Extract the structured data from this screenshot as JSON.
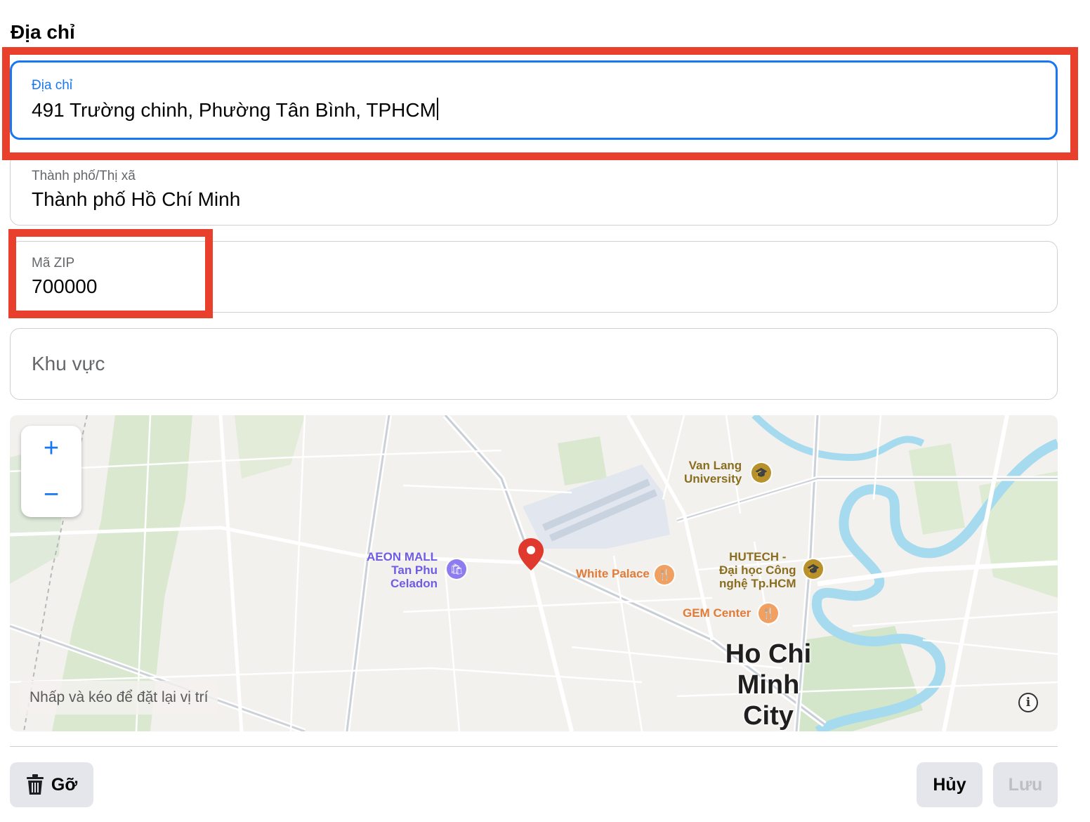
{
  "section_title": "Địa chỉ",
  "address_field": {
    "label": "Địa chỉ",
    "value": "491 Trường chinh, Phường Tân Bình, TPHCM"
  },
  "city_field": {
    "label": "Thành phố/Thị xã",
    "value": "Thành phố Hồ Chí Minh"
  },
  "zip_field": {
    "label": "Mã ZIP",
    "value": "700000"
  },
  "region_field": {
    "placeholder": "Khu vực"
  },
  "map": {
    "zoom_in": "+",
    "zoom_out": "−",
    "hint": "Nhấp và kéo để đặt lại vị trí",
    "info": "i",
    "city_name_line1": "Ho Chi",
    "city_name_line2": "Minh City",
    "pois": [
      {
        "name": "Van Lang University",
        "line1": "Van Lang",
        "line2": "University",
        "color": "#8a6d1f",
        "icon": "school-icon"
      },
      {
        "name": "AEON MALL Tan Phu Celadon",
        "line1": "AEON MALL",
        "line2": "Tan Phu",
        "line3": "Celadon",
        "color": "#6e5ce6",
        "icon": "shopping-icon"
      },
      {
        "name": "White Palace",
        "line1": "White Palace",
        "color": "#e07b39",
        "icon": "restaurant-icon"
      },
      {
        "name": "HUTECH - Đại học Công nghệ Tp.HCM",
        "line1": "HUTECH -",
        "line2": "Đại học Công",
        "line3": "nghệ Tp.HCM",
        "color": "#8a6d1f",
        "icon": "school-icon"
      },
      {
        "name": "GEM Center",
        "line1": "GEM Center",
        "color": "#e07b39",
        "icon": "restaurant-icon"
      }
    ]
  },
  "buttons": {
    "remove": "Gỡ",
    "cancel": "Hủy",
    "save": "Lưu"
  },
  "colors": {
    "highlight": "#e8402d",
    "focus": "#1877f2",
    "pin": "#e03a2e"
  }
}
